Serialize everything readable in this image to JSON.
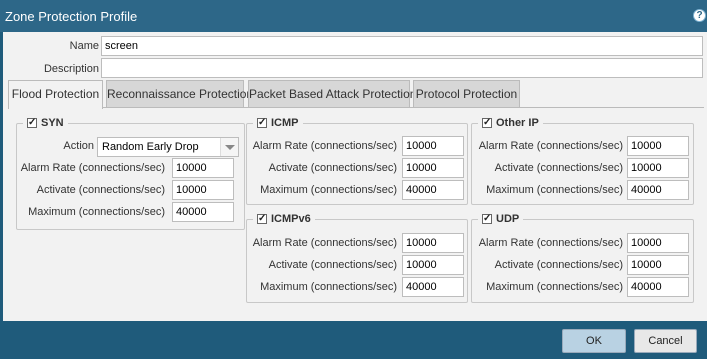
{
  "window": {
    "title": "Zone Protection Profile"
  },
  "form": {
    "name_label": "Name",
    "name_value": "screen",
    "description_label": "Description",
    "description_value": ""
  },
  "tabs": [
    {
      "label": "Flood Protection",
      "active": true
    },
    {
      "label": "Reconnaissance Protection",
      "active": false
    },
    {
      "label": "Packet Based Attack Protection",
      "active": false
    },
    {
      "label": "Protocol Protection",
      "active": false
    }
  ],
  "labels": {
    "action": "Action",
    "alarm_rate": "Alarm Rate (connections/sec)",
    "activate": "Activate (connections/sec)",
    "maximum": "Maximum (connections/sec)"
  },
  "groups": {
    "syn": {
      "title": "SYN",
      "checked": true,
      "action": "Random Early Drop",
      "alarm_rate": "10000",
      "activate": "10000",
      "maximum": "40000"
    },
    "icmp": {
      "title": "ICMP",
      "checked": true,
      "alarm_rate": "10000",
      "activate": "10000",
      "maximum": "40000"
    },
    "other_ip": {
      "title": "Other IP",
      "checked": true,
      "alarm_rate": "10000",
      "activate": "10000",
      "maximum": "40000"
    },
    "icmpv6": {
      "title": "ICMPv6",
      "checked": true,
      "alarm_rate": "10000",
      "activate": "10000",
      "maximum": "40000"
    },
    "udp": {
      "title": "UDP",
      "checked": true,
      "alarm_rate": "10000",
      "activate": "10000",
      "maximum": "40000"
    }
  },
  "buttons": {
    "ok": "OK",
    "cancel": "Cancel"
  },
  "colors": {
    "titlebar": "#2d6788",
    "footer": "#1f5b7b",
    "ok_button": "#b9d2e3"
  },
  "icons": {
    "help": "help-icon",
    "checkbox": "checkbox-icon",
    "dropdown": "chevron-down-icon"
  }
}
